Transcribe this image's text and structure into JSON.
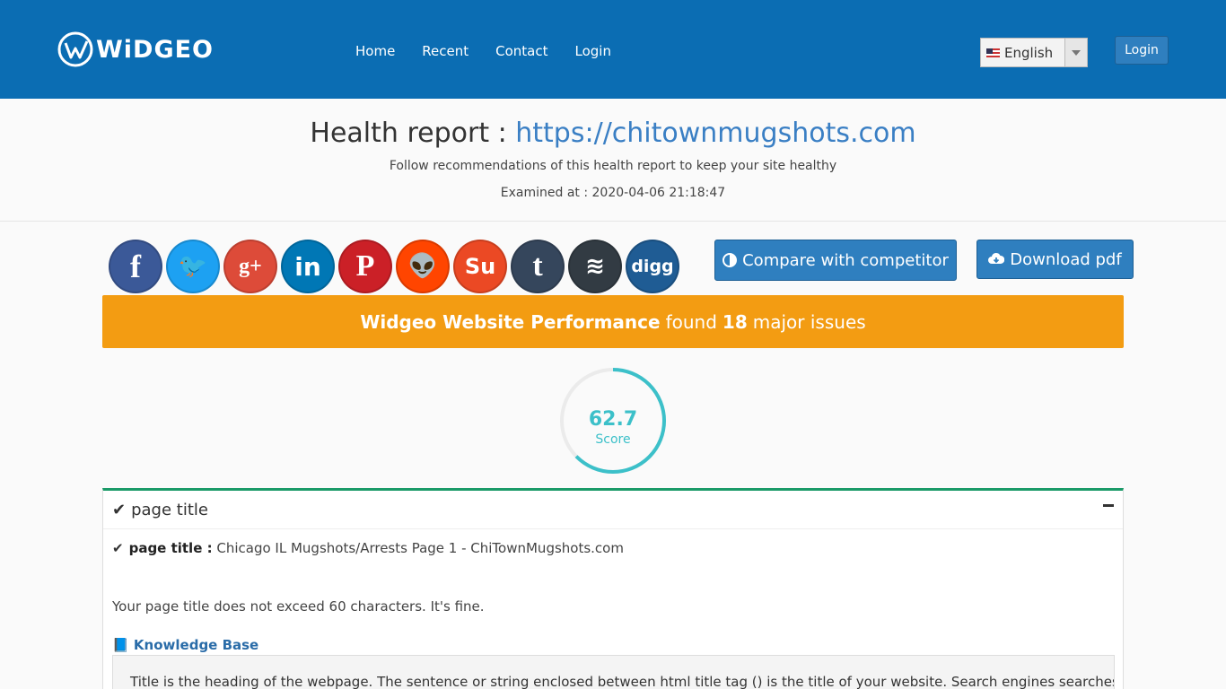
{
  "header": {
    "logo_text": "WiDGEO",
    "nav": [
      "Home",
      "Recent",
      "Contact",
      "Login"
    ],
    "language": "English",
    "login_label": "Login"
  },
  "hero": {
    "title_prefix": "Health report : ",
    "url": "https://chitownmugshots.com",
    "subtitle": "Follow recommendations of this health report to keep your site healthy",
    "examined": "Examined at : 2020-04-06 21:18:47"
  },
  "social": [
    {
      "name": "facebook",
      "glyph": "f"
    },
    {
      "name": "twitter",
      "glyph": "🐦"
    },
    {
      "name": "google-plus",
      "glyph": "g+"
    },
    {
      "name": "linkedin",
      "glyph": "in"
    },
    {
      "name": "pinterest",
      "glyph": "P"
    },
    {
      "name": "reddit",
      "glyph": "👽"
    },
    {
      "name": "stumbleupon",
      "glyph": "Su"
    },
    {
      "name": "tumblr",
      "glyph": "t"
    },
    {
      "name": "buffer",
      "glyph": "≋"
    },
    {
      "name": "digg",
      "glyph": "digg"
    }
  ],
  "actions": {
    "compare_label": "Compare with competitor",
    "download_label": "Download pdf"
  },
  "banner": {
    "brand": "Widgeo Website Performance",
    "found": "found",
    "count": "18",
    "suffix": "major issues"
  },
  "score": {
    "value": "62.7",
    "label": "Score",
    "fraction": 0.627,
    "color": "#3cc0c9"
  },
  "panel": {
    "title": "page title",
    "label": "page title :",
    "value": "Chicago IL Mugshots/Arrests Page 1 - ChiTownMugshots.com",
    "message": "Your page title does not exceed 60 characters. It's fine.",
    "kb_label": "Knowledge Base",
    "kb_text": "Title is the heading of the webpage. The sentence or string enclosed between html title tag () is the title of your website. Search engines searches for the title"
  }
}
